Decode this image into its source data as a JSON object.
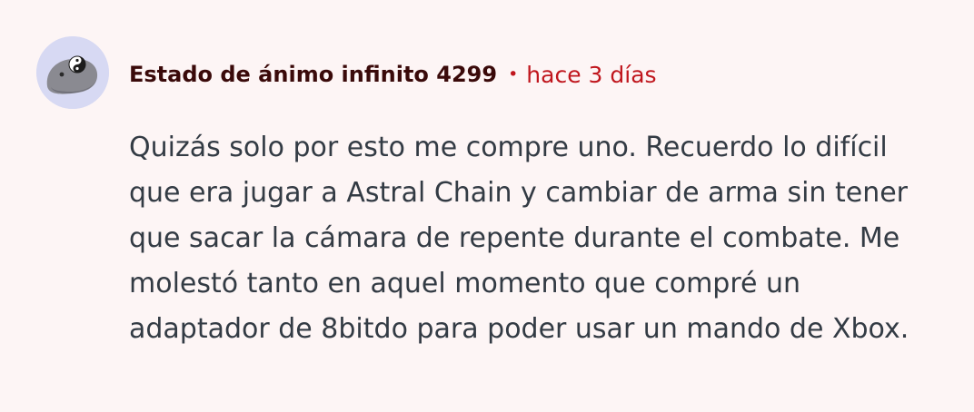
{
  "comment": {
    "author": "Estado de ánimo infinito 4299",
    "separator": "•",
    "timestamp": "hace 3 días",
    "text": "Quizás solo por esto me compre uno. Recuerdo lo difícil que era jugar a Astral Chain y cambiar de arma sin tener que sacar la cámara de repente durante el combate. Me molestó tanto en aquel momento que compré un adaptador de 8bitdo para poder usar un mando de Xbox."
  },
  "colors": {
    "background": "#fdf5f5",
    "author": "#3a0a0a",
    "accent": "#c0161d",
    "text": "#333b44",
    "avatar_bg": "#d7d9f3"
  }
}
